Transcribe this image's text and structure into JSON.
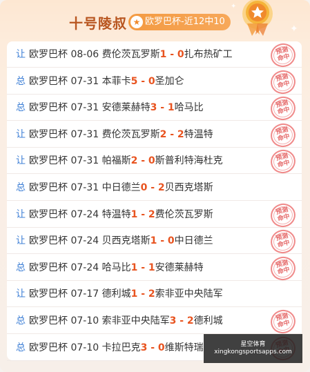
{
  "header": {
    "title": "十号陵叔",
    "record": "欧罗巴杯-近12中10"
  },
  "stamp_text": [
    "预测",
    "命中"
  ],
  "matches": [
    {
      "kind": "让",
      "league": "欧罗巴杯",
      "date": "08-06",
      "home": "费伦茨瓦罗斯",
      "score": "1 - 0",
      "away": "扎布热矿工",
      "hit": true
    },
    {
      "kind": "总",
      "league": "欧罗巴杯",
      "date": "07-31",
      "home": "本菲卡",
      "score": "5 - 0",
      "away": "圣加仑",
      "hit": true
    },
    {
      "kind": "总",
      "league": "欧罗巴杯",
      "date": "07-31",
      "home": "安德莱赫特",
      "score": "3 - 1",
      "away": "哈马比",
      "hit": true
    },
    {
      "kind": "让",
      "league": "欧罗巴杯",
      "date": "07-31",
      "home": "费伦茨瓦罗斯",
      "score": "2 - 2",
      "away": "特温特",
      "hit": true
    },
    {
      "kind": "让",
      "league": "欧罗巴杯",
      "date": "07-31",
      "home": "帕福斯",
      "score": "2 - 0",
      "away": "斯普利特海杜克",
      "hit": true
    },
    {
      "kind": "总",
      "league": "欧罗巴杯",
      "date": "07-31",
      "home": "中日德兰",
      "score": "0 - 2",
      "away": "贝西克塔斯",
      "hit": false
    },
    {
      "kind": "让",
      "league": "欧罗巴杯",
      "date": "07-24",
      "home": "特温特",
      "score": "1 - 2",
      "away": "费伦茨瓦罗斯",
      "hit": true
    },
    {
      "kind": "让",
      "league": "欧罗巴杯",
      "date": "07-24",
      "home": "贝西克塔斯",
      "score": "1 - 0",
      "away": "中日德兰",
      "hit": true
    },
    {
      "kind": "总",
      "league": "欧罗巴杯",
      "date": "07-24",
      "home": "哈马比",
      "score": "1 - 1",
      "away": "安德莱赫特",
      "hit": true
    },
    {
      "kind": "让",
      "league": "欧罗巴杯",
      "date": "07-17",
      "home": "德利城",
      "score": "1 - 2",
      "away": "索非亚中央陆军",
      "hit": false
    },
    {
      "kind": "总",
      "league": "欧罗巴杯",
      "date": "07-10",
      "home": "索非亚中央陆军",
      "score": "3 - 2",
      "away": "德利城",
      "hit": true
    },
    {
      "kind": "总",
      "league": "欧罗巴杯",
      "date": "07-10",
      "home": "卡拉巴克",
      "score": "3 - 0",
      "away": "维斯特瑞",
      "hit": true
    }
  ],
  "watermark": {
    "line1": "星空体育",
    "line2": "xingkongsportsapps.com"
  },
  "colors": {
    "title": "#b8551f",
    "pill": "#f39a42",
    "kind": "#3d7fd6",
    "score": "#e8531f",
    "stamp": "#e56a6a"
  }
}
